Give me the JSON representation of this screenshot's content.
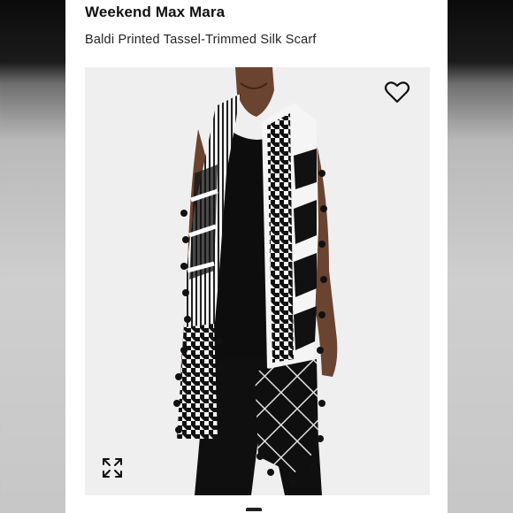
{
  "product": {
    "brand": "Weekend Max Mara",
    "name": "Baldi Printed Tassel-Trimmed Silk Scarf"
  },
  "icons": {
    "favorite": "heart-icon",
    "expand": "expand-arrows-icon"
  },
  "colors": {
    "card_background": "#ffffff",
    "image_background": "#efefef",
    "text_primary": "#111111",
    "scarf_black": "#111111",
    "scarf_white": "#f5f5f5"
  }
}
